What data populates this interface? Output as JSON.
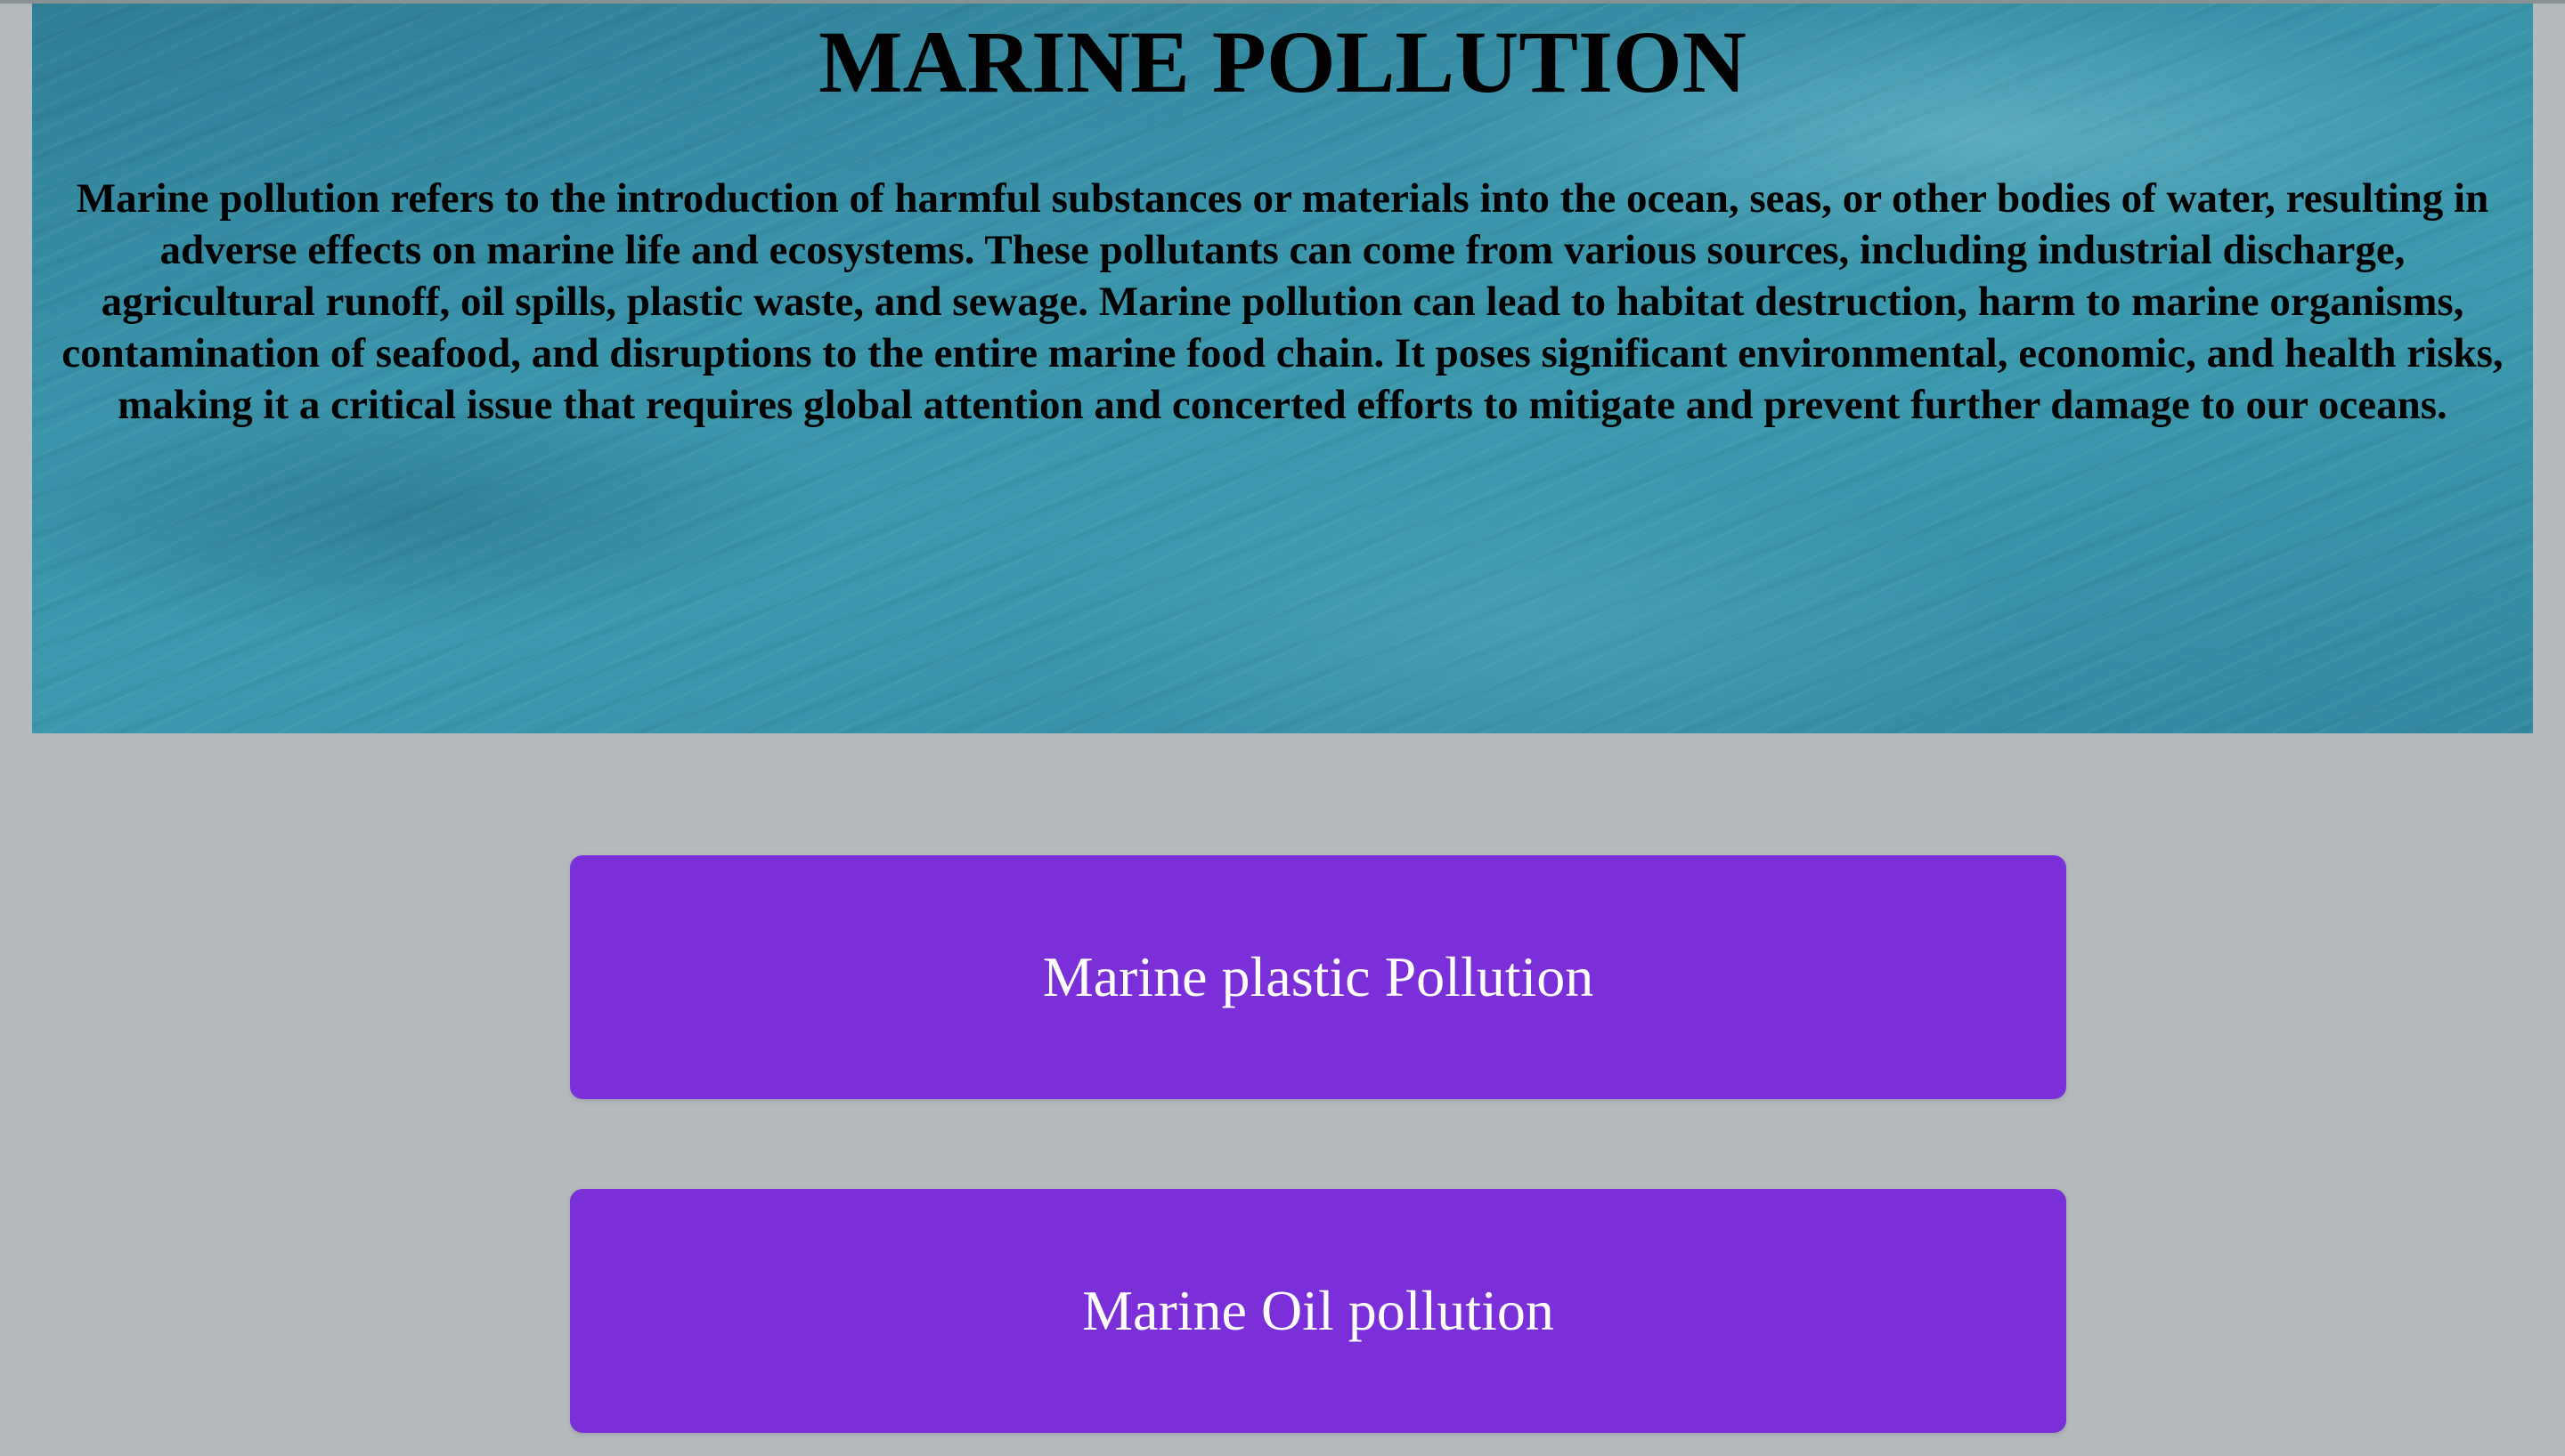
{
  "hero": {
    "title": "MARINE POLLUTION",
    "description": "Marine pollution refers to the introduction of harmful substances or materials into the ocean, seas, or other bodies of water, resulting in adverse effects on marine life and ecosystems. These pollutants can come from various sources, including industrial discharge, agricultural runoff, oil spills, plastic waste, and sewage. Marine pollution can lead to habitat destruction, harm to marine organisms, contamination of seafood, and disruptions to the entire marine food chain. It poses significant environmental, economic, and health risks, making it a critical issue that requires global attention and concerted efforts to mitigate and prevent further damage to our oceans."
  },
  "topics": [
    {
      "label": "Marine plastic Pollution"
    },
    {
      "label": "Marine Oil pollution"
    }
  ],
  "colors": {
    "page_background": "#b3b9bc",
    "button_background": "#7b2fd9",
    "button_text": "#ffffff",
    "hero_water": "#3a93a9"
  }
}
